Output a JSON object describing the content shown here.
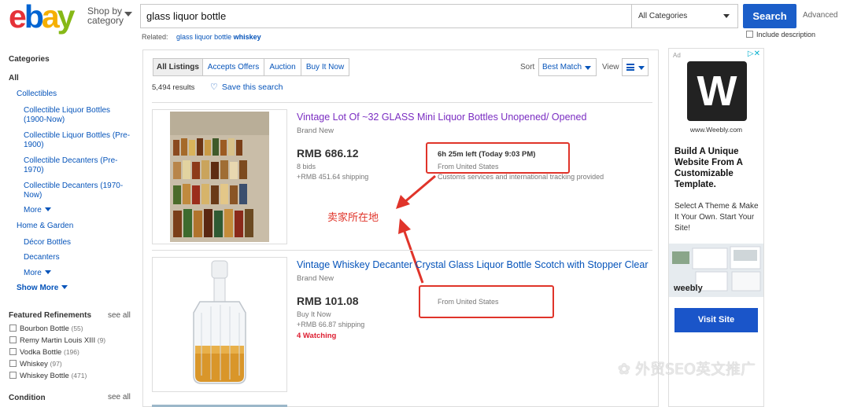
{
  "header": {
    "logo": [
      "e",
      "b",
      "a",
      "y"
    ],
    "shop_by_line1": "Shop by",
    "shop_by_line2": "category",
    "search_value": "glass liquor bottle",
    "category_select": "All Categories",
    "search_button": "Search",
    "advanced": "Advanced",
    "related_label": "Related:",
    "related_link_prefix": "glass liquor bottle",
    "related_link_bold": "whiskey",
    "include_description": "Include description"
  },
  "sidebar": {
    "categories_heading": "Categories",
    "all": "All",
    "collectibles": "Collectibles",
    "sub_items": [
      {
        "line1": "Collectible Liquor Bottles",
        "line2": "(1900-Now)"
      },
      {
        "line1": "Collectible Liquor Bottles (Pre-",
        "line2": "1900)"
      },
      {
        "line1": "Collectible Decanters (Pre-",
        "line2": "1970)"
      },
      {
        "line1": "Collectible Decanters (1970-",
        "line2": "Now)"
      }
    ],
    "more1": "More",
    "home_garden": "Home & Garden",
    "home_sub": [
      "Décor Bottles",
      "Decanters"
    ],
    "more2": "More",
    "show_more": "Show More",
    "featured_heading": "Featured Refinements",
    "see_all_1": "see all",
    "refinements": [
      {
        "label": "Bourbon Bottle",
        "count": "(55)"
      },
      {
        "label": "Remy Martin Louis XIII",
        "count": "(9)"
      },
      {
        "label": "Vodka Bottle",
        "count": "(196)"
      },
      {
        "label": "Whiskey",
        "count": "(97)"
      },
      {
        "label": "Whiskey Bottle",
        "count": "(471)"
      }
    ],
    "condition_heading": "Condition",
    "see_all_2": "see all"
  },
  "toolbar": {
    "tabs": [
      "All Listings",
      "Accepts Offers",
      "Auction",
      "Buy It Now"
    ],
    "results": "5,494 results",
    "save_search": "Save this search",
    "sort_label": "Sort",
    "sort_value": "Best Match",
    "view_label": "View"
  },
  "items": [
    {
      "title": "Vintage Lot Of ~32 GLASS Mini Liquor Bottles Unopened/ Opened",
      "condition": "Brand New",
      "price": "RMB 686.12",
      "line2": "8 bids",
      "shipping": "+RMB 451.64 shipping",
      "time_left": "6h 25m left (Today 9:03 PM)",
      "from": "From United States",
      "customs": "Customs services and international tracking provided"
    },
    {
      "title": "Vintage Whiskey Decanter Crystal Glass Liquor Bottle Scotch with Stopper Clear",
      "condition": "Brand New",
      "price": "RMB 101.08",
      "line2": "Buy It Now",
      "shipping": "+RMB 66.87 shipping",
      "watching": "4 Watching",
      "from": "From United States"
    }
  ],
  "annotation": "卖家所在地",
  "ad": {
    "label": "Ad",
    "domain": "www.Weebly.com",
    "headline": "Build A Unique Website From A Customizable Template.",
    "body": "Select A Theme & Make It Your Own. Start Your Site!",
    "brand": "weebly",
    "cta": "Visit Site"
  },
  "watermark": "外贸SEO英文推广",
  "colors": {
    "link": "#0654ba",
    "search_button": "#1b5ec9",
    "annotation_red": "#e0342a",
    "watching_red": "#dd1e31"
  }
}
